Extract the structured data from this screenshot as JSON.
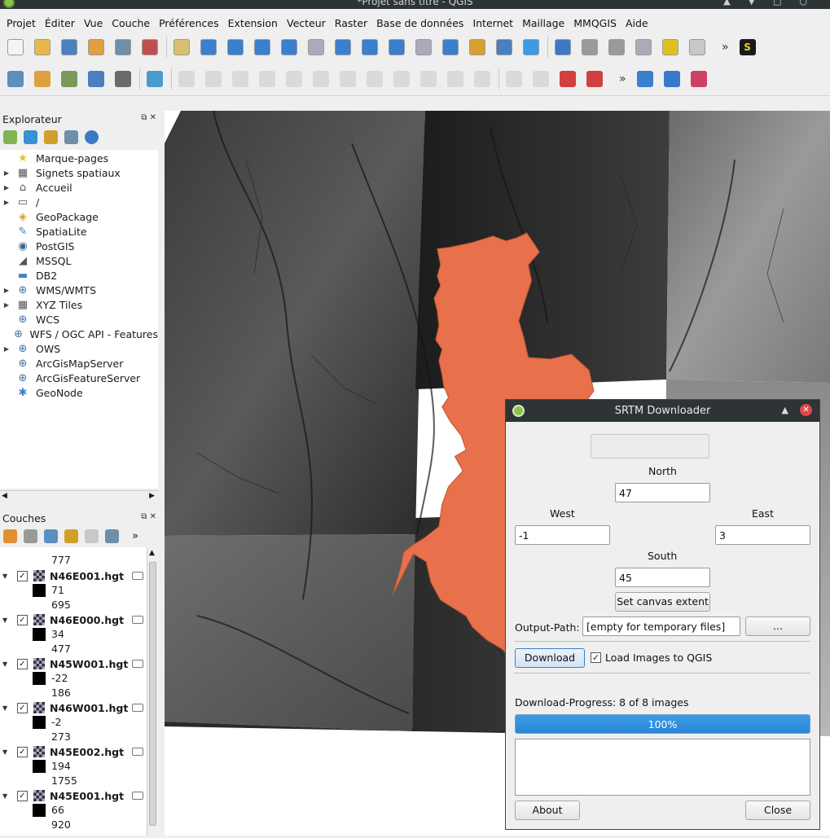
{
  "window": {
    "title": "*Projet sans titre - QGIS"
  },
  "menu": [
    "Projet",
    "Éditer",
    "Vue",
    "Couche",
    "Préférences",
    "Extension",
    "Vecteur",
    "Raster",
    "Base de données",
    "Internet",
    "Maillage",
    "MMQGIS",
    "Aide"
  ],
  "browser": {
    "title": "Explorateur",
    "items": [
      {
        "label": "Marque-pages",
        "icon": "star-icon",
        "expand": ""
      },
      {
        "label": "Signets spatiaux",
        "icon": "bookmark-icon",
        "expand": "▶"
      },
      {
        "label": "Accueil",
        "icon": "home-icon",
        "expand": "▶"
      },
      {
        "label": "/",
        "icon": "folder-icon",
        "expand": "▶"
      },
      {
        "label": "GeoPackage",
        "icon": "geopackage-icon",
        "expand": ""
      },
      {
        "label": "SpatiaLite",
        "icon": "spatialite-icon",
        "expand": ""
      },
      {
        "label": "PostGIS",
        "icon": "postgis-icon",
        "expand": ""
      },
      {
        "label": "MSSQL",
        "icon": "mssql-icon",
        "expand": ""
      },
      {
        "label": "DB2",
        "icon": "db2-icon",
        "expand": ""
      },
      {
        "label": "WMS/WMTS",
        "icon": "globe-icon",
        "expand": "▶"
      },
      {
        "label": "XYZ Tiles",
        "icon": "grid-icon",
        "expand": "▶"
      },
      {
        "label": "WCS",
        "icon": "globe-icon",
        "expand": ""
      },
      {
        "label": "WFS / OGC API - Features",
        "icon": "globe-icon",
        "expand": ""
      },
      {
        "label": "OWS",
        "icon": "globe-icon",
        "expand": "▶"
      },
      {
        "label": "ArcGisMapServer",
        "icon": "globe-icon",
        "expand": ""
      },
      {
        "label": "ArcGisFeatureServer",
        "icon": "globe-icon",
        "expand": ""
      },
      {
        "label": "GeoNode",
        "icon": "geonode-icon",
        "expand": ""
      }
    ]
  },
  "layers": {
    "title": "Couches",
    "top_value": "777",
    "items": [
      {
        "name": "N46E001.hgt",
        "min": "71",
        "max": "695"
      },
      {
        "name": "N46E000.hgt",
        "min": "34",
        "max": "477"
      },
      {
        "name": "N45W001.hgt",
        "min": "-22",
        "max": "186"
      },
      {
        "name": "N46W001.hgt",
        "min": "-2",
        "max": "273"
      },
      {
        "name": "N45E002.hgt",
        "min": "194",
        "max": "1755"
      },
      {
        "name": "N45E001.hgt",
        "min": "66",
        "max": "920"
      }
    ]
  },
  "dialog": {
    "title": "SRTM Downloader",
    "north_label": "North",
    "north_value": "47",
    "west_label": "West",
    "west_value": "-1",
    "east_label": "East",
    "east_value": "3",
    "south_label": "South",
    "south_value": "45",
    "set_extent": "Set canvas extent",
    "output_label": "Output-Path:",
    "output_placeholder": "[empty for temporary files]",
    "browse": "...",
    "download": "Download",
    "load_images": "Load Images to QGIS",
    "load_checked": true,
    "progress_label": "Download-Progress: 8 of 8 images",
    "progress_text": "100%",
    "progress_value": 1.0,
    "about": "About",
    "close": "Close"
  },
  "colors": {
    "accent": "#2a86d6",
    "polygon": "#e8704a",
    "titlebar": "#2e3436"
  }
}
